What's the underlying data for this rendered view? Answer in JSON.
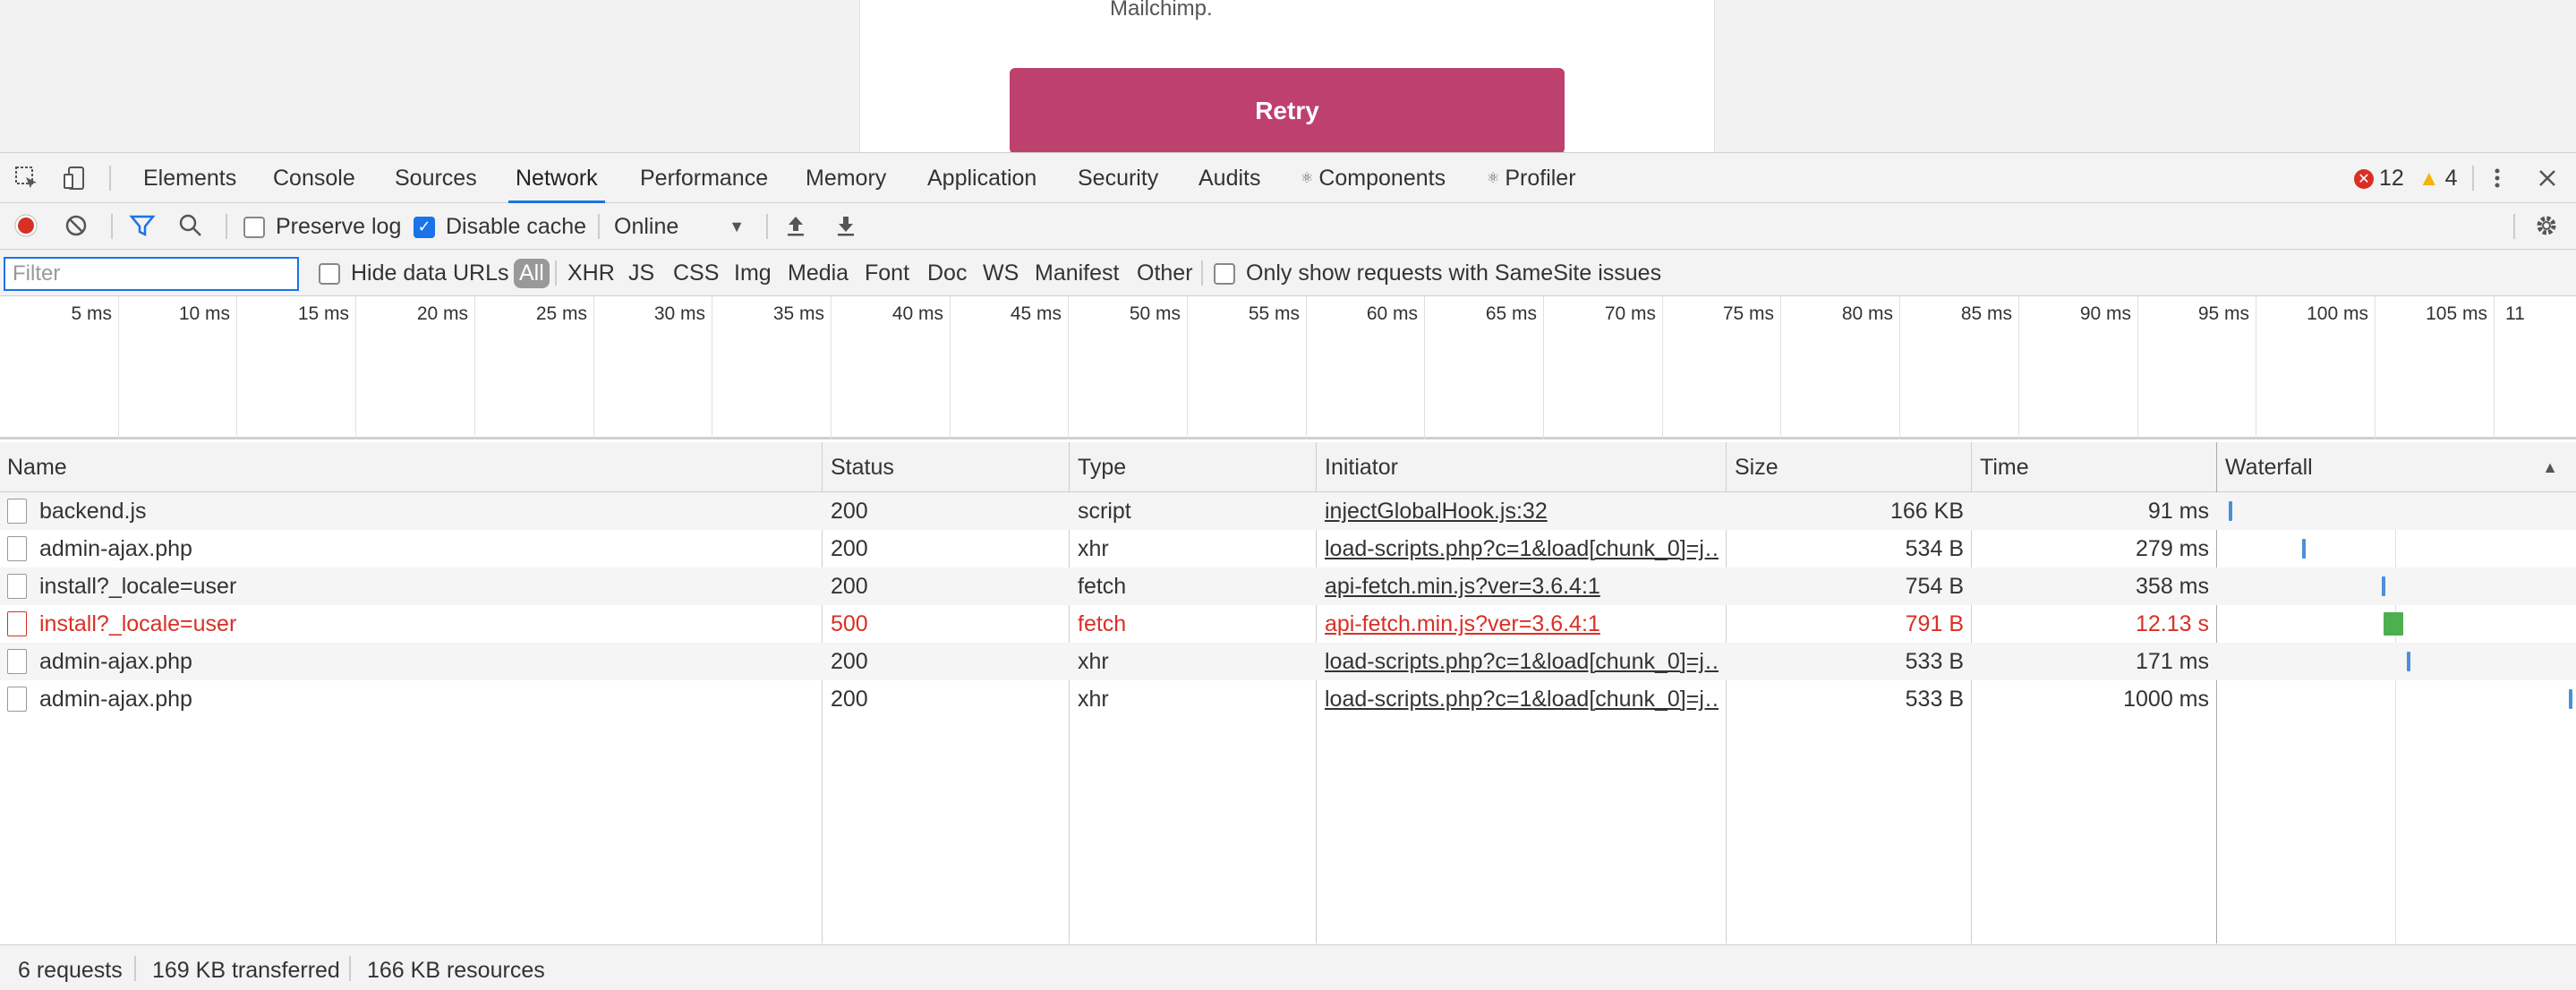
{
  "page": {
    "text_fragment": "Mailchimp.",
    "retry_label": "Retry",
    "retry_color": "#be406d"
  },
  "devtools": {
    "tabs": [
      "Elements",
      "Console",
      "Sources",
      "Network",
      "Performance",
      "Memory",
      "Application",
      "Security",
      "Audits",
      "Components",
      "Profiler"
    ],
    "active_tab": "Network",
    "errors_count": "12",
    "warnings_count": "4",
    "accent": "#1a73e8"
  },
  "toolbar": {
    "preserve_log": "Preserve log",
    "disable_cache": "Disable cache",
    "throttle": "Online"
  },
  "filterbar": {
    "placeholder": "Filter",
    "hide_data_urls": "Hide data URLs",
    "types": [
      "All",
      "XHR",
      "JS",
      "CSS",
      "Img",
      "Media",
      "Font",
      "Doc",
      "WS",
      "Manifest",
      "Other"
    ],
    "samesite": "Only show requests with SameSite issues"
  },
  "overview": {
    "ticks": [
      "5 ms",
      "10 ms",
      "15 ms",
      "20 ms",
      "25 ms",
      "30 ms",
      "35 ms",
      "40 ms",
      "45 ms",
      "50 ms",
      "55 ms",
      "60 ms",
      "65 ms",
      "70 ms",
      "75 ms",
      "80 ms",
      "85 ms",
      "90 ms",
      "95 ms",
      "100 ms",
      "105 ms",
      "11"
    ]
  },
  "table": {
    "headers": {
      "name": "Name",
      "status": "Status",
      "type": "Type",
      "initiator": "Initiator",
      "size": "Size",
      "time": "Time",
      "waterfall": "Waterfall"
    },
    "rows": [
      {
        "name": "backend.js",
        "status": "200",
        "type": "script",
        "initiator": "injectGlobalHook.js:32",
        "size": "166 KB",
        "time": "91 ms",
        "error": false,
        "wf_start": 0.02,
        "wf_color": "#4a90d9"
      },
      {
        "name": "admin-ajax.php",
        "status": "200",
        "type": "xhr",
        "initiator": "load-scripts.php?c=1&load[chunk_0]=j…",
        "size": "534 B",
        "time": "279 ms",
        "error": false,
        "wf_start": 0.23,
        "wf_color": "#4a90d9"
      },
      {
        "name": "install?_locale=user",
        "status": "200",
        "type": "fetch",
        "initiator": "api-fetch.min.js?ver=3.6.4:1",
        "size": "754 B",
        "time": "358 ms",
        "error": false,
        "wf_start": 0.46,
        "wf_color": "#4a90d9"
      },
      {
        "name": "install?_locale=user",
        "status": "500",
        "type": "fetch",
        "initiator": "api-fetch.min.js?ver=3.6.4:1",
        "size": "791 B",
        "time": "12.13 s",
        "error": true,
        "wf_start": 0.465,
        "wf_color": "#4caf50"
      },
      {
        "name": "admin-ajax.php",
        "status": "200",
        "type": "xhr",
        "initiator": "load-scripts.php?c=1&load[chunk_0]=j…",
        "size": "533 B",
        "time": "171 ms",
        "error": false,
        "wf_start": 0.53,
        "wf_color": "#4a90d9"
      },
      {
        "name": "admin-ajax.php",
        "status": "200",
        "type": "xhr",
        "initiator": "load-scripts.php?c=1&load[chunk_0]=j…",
        "size": "533 B",
        "time": "1000 ms",
        "error": false,
        "wf_start": 0.995,
        "wf_color": "#4a90d9"
      }
    ]
  },
  "status": {
    "requests": "6 requests",
    "transferred": "169 KB transferred",
    "resources": "166 KB resources"
  }
}
